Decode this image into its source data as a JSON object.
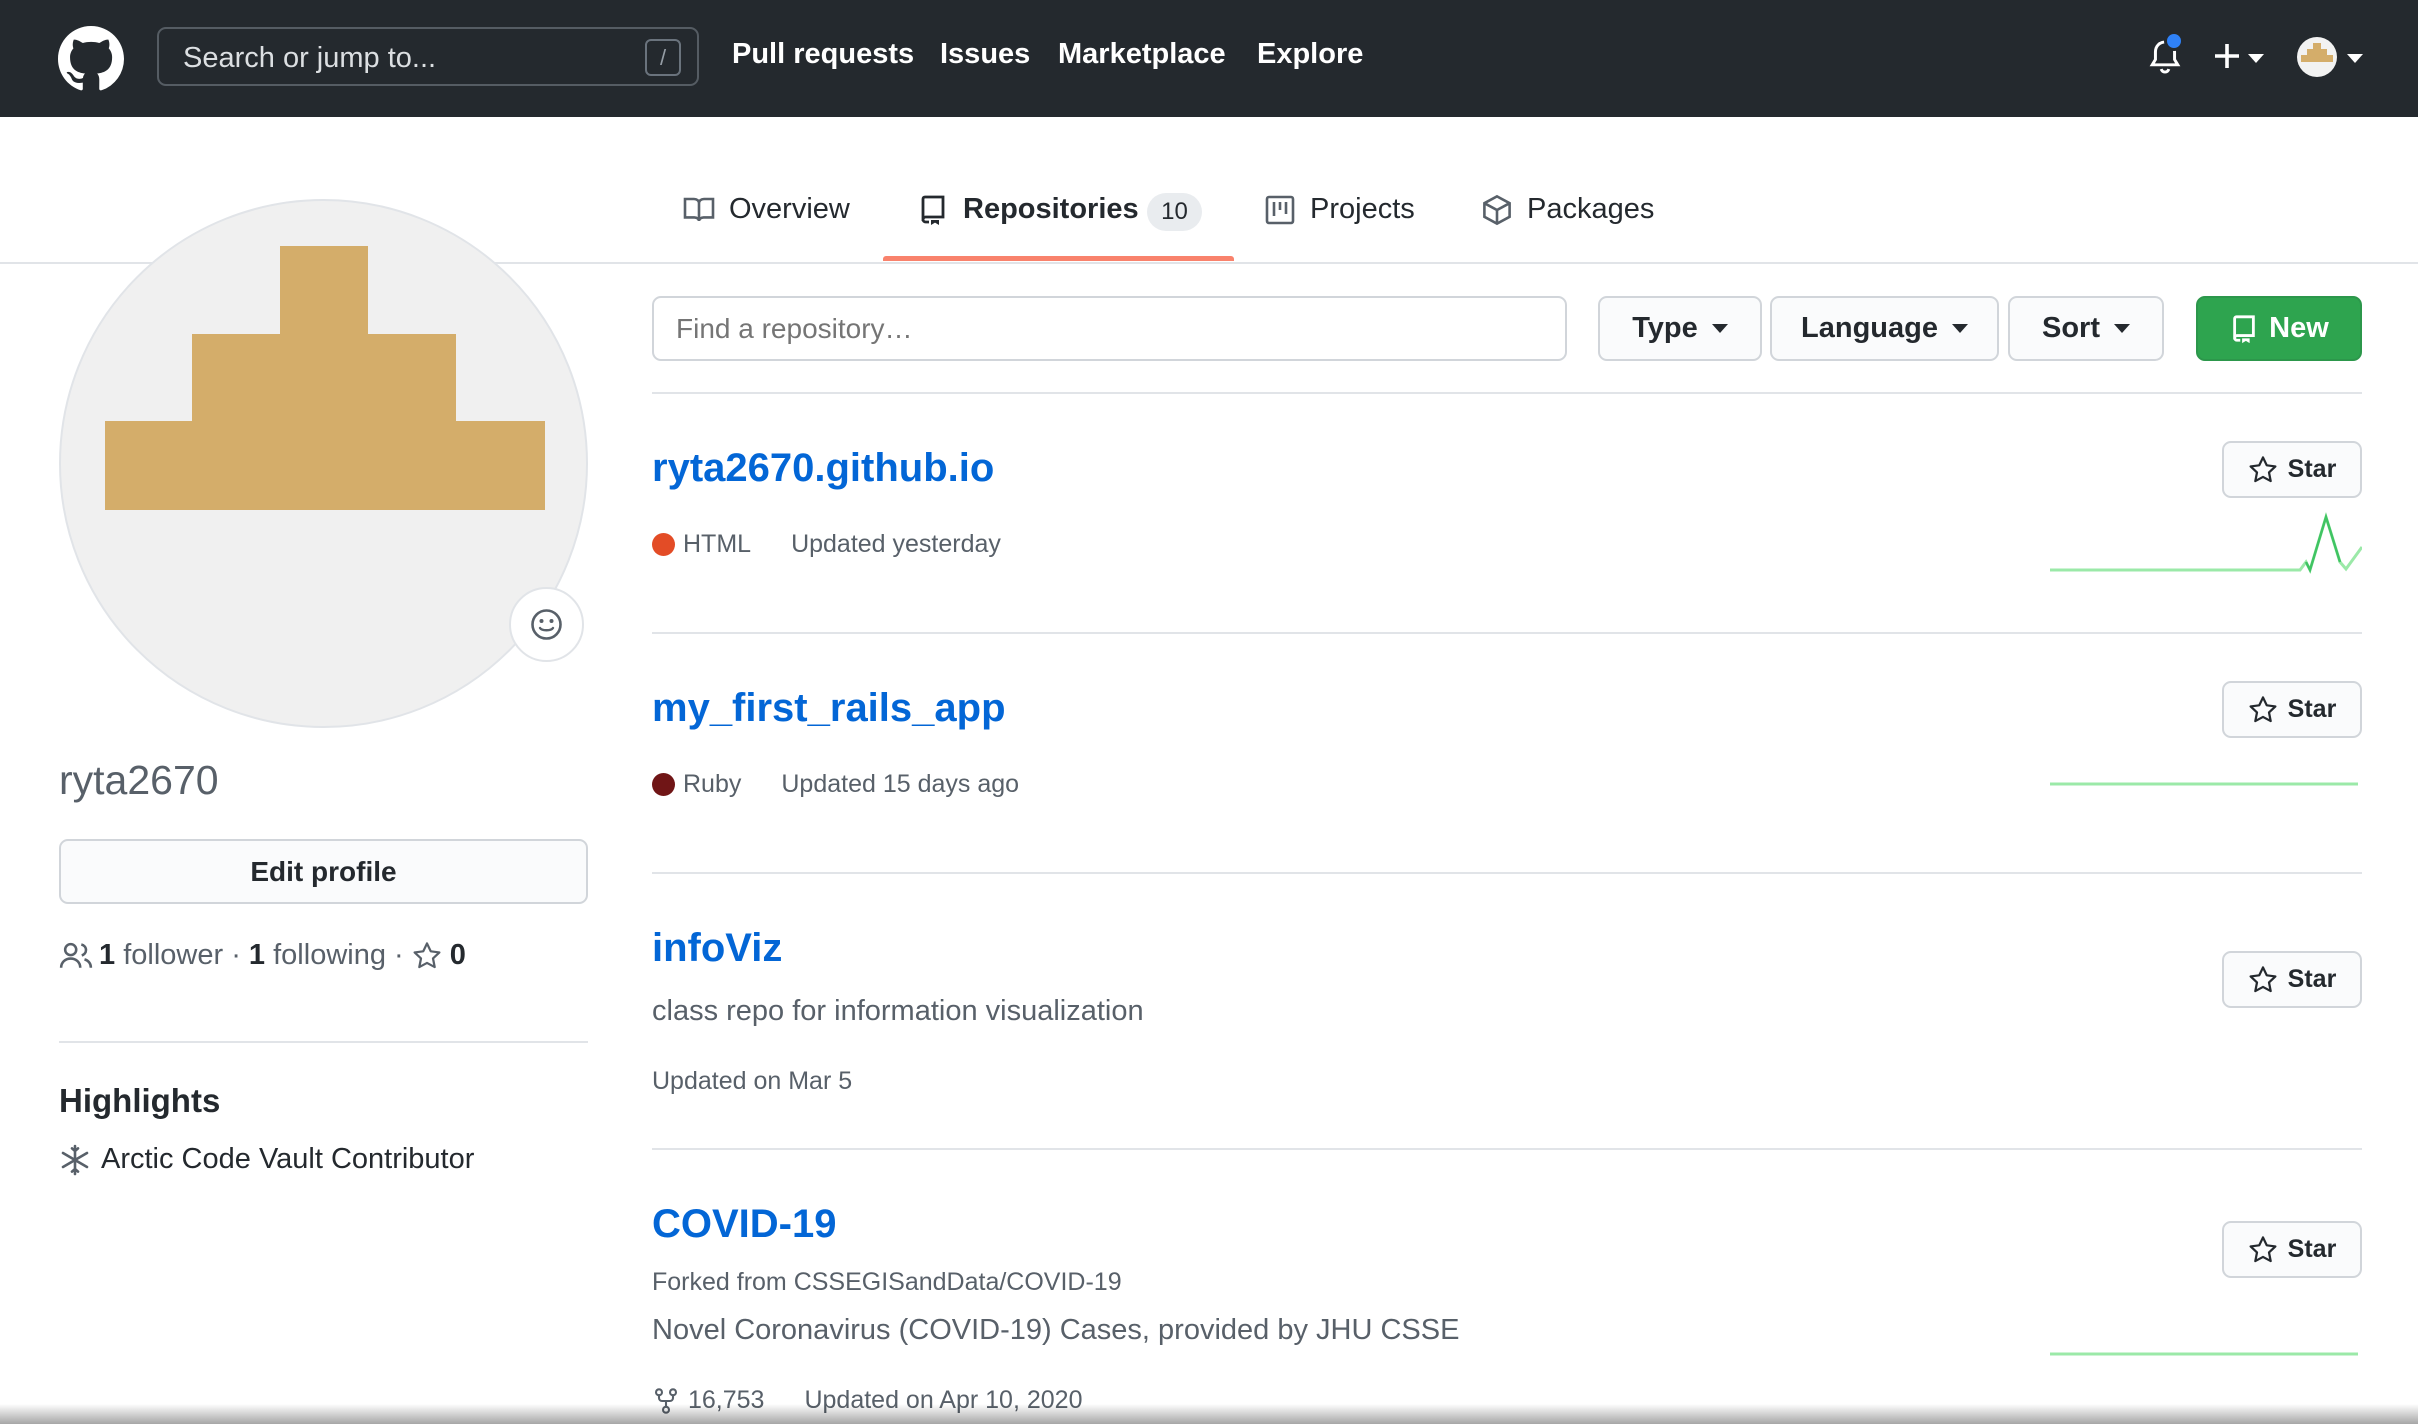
{
  "header": {
    "search_placeholder": "Search or jump to...",
    "search_shortcut": "/",
    "nav": [
      "Pull requests",
      "Issues",
      "Marketplace",
      "Explore"
    ]
  },
  "tabs": {
    "overview": "Overview",
    "repositories": "Repositories",
    "repositories_count": "10",
    "projects": "Projects",
    "packages": "Packages"
  },
  "profile": {
    "username": "ryta2670",
    "edit_label": "Edit profile",
    "followers_count": "1",
    "followers_label": "follower",
    "following_count": "1",
    "following_label": "following",
    "stars_count": "0",
    "highlights_title": "Highlights",
    "highlight_item": "Arctic Code Vault Contributor",
    "avatar_color": "#d4ad6a"
  },
  "filters": {
    "find_placeholder": "Find a repository…",
    "type_label": "Type",
    "language_label": "Language",
    "sort_label": "Sort",
    "new_label": "New"
  },
  "repos": [
    {
      "name": "ryta2670.github.io",
      "language": "HTML",
      "language_color": "#e34c26",
      "updated": "Updated yesterday",
      "star_label": "Star"
    },
    {
      "name": "my_first_rails_app",
      "language": "Ruby",
      "language_color": "#701516",
      "updated": "Updated 15 days ago",
      "star_label": "Star"
    },
    {
      "name": "infoViz",
      "description": "class repo for information visualization",
      "updated": "Updated on Mar 5",
      "star_label": "Star"
    },
    {
      "name": "COVID-19",
      "forked_from": "Forked from CSSEGISandData/COVID-19",
      "description": "Novel Coronavirus (COVID-19) Cases, provided by JHU CSSE",
      "forks": "16,753",
      "updated": "Updated on Apr 10, 2020",
      "star_label": "Star"
    }
  ]
}
